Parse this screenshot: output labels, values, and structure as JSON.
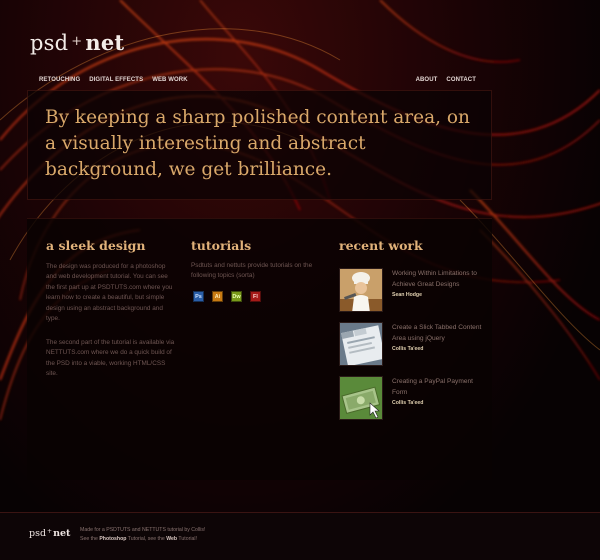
{
  "logo": {
    "w1": "psd",
    "plus": "+",
    "w2": "net"
  },
  "nav": {
    "left": [
      "RETOUCHING",
      "DIGITAL EFFECTS",
      "WEB WORK"
    ],
    "right": [
      "ABOUT",
      "CONTACT"
    ]
  },
  "hero": {
    "text": "By keeping a sharp polished content area, on a visually interesting and abstract background, we get brilliance."
  },
  "col1": {
    "title": "a sleek design",
    "p1": "The design was produced for a photoshop and web development tutorial.  You can see the first part up at PSDTUTS.com where you learn how to create a beautiful, but simple design using an abstract background and type.",
    "p2": "The second part of the tutorial is available via NETTUTS.com where we do a quick build of the PSD into a viable, working HTML/CSS site."
  },
  "col2": {
    "title": "tutorials",
    "text": "Psdtuts and nettuts provide tutorials on the following topics (sorta)",
    "icons": [
      "Ps",
      "Ai",
      "Dw",
      "Fl"
    ]
  },
  "col3": {
    "title": "recent work",
    "items": [
      {
        "title": "Working Within Limitations to Achieve Great Designs",
        "author": "Sean Hodge"
      },
      {
        "title": "Create a Slick Tabbed Content Area using jQuery",
        "author": "Collis Ta'eed"
      },
      {
        "title": "Creating a PayPal Payment Form",
        "author": "Collis Ta'eed"
      }
    ]
  },
  "footer": {
    "logo_w1": "psd",
    "logo_plus": "+",
    "logo_w2": "net",
    "line1": "Made for a PSDTUTS and NETTUTS tutorial by Collis!",
    "line2_pre": "See the ",
    "line2_link1": "Photoshop",
    "line2_mid": " Tutorial, see the ",
    "line2_link2": "Web",
    "line2_post": " Tutorial!"
  }
}
